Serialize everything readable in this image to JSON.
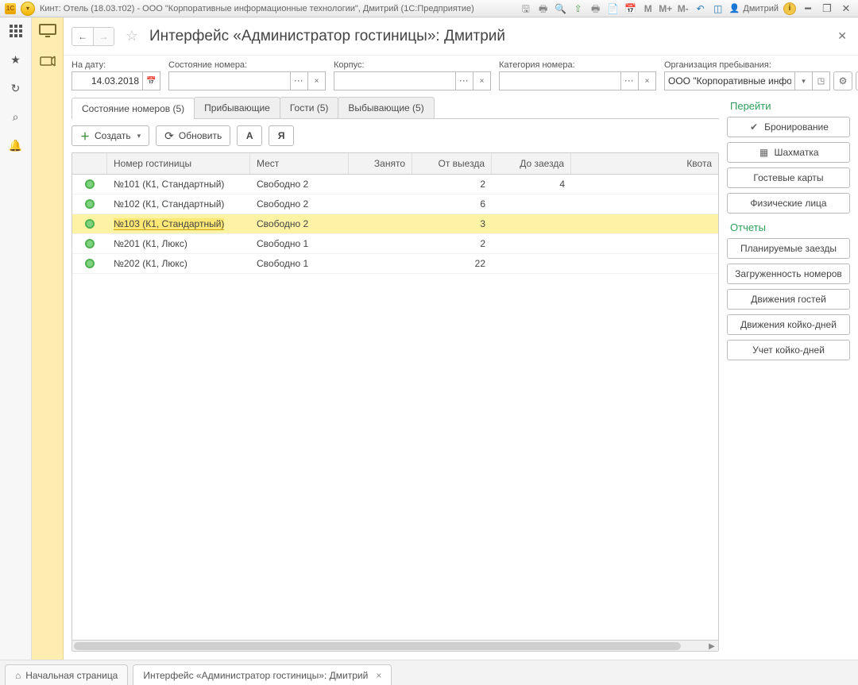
{
  "titlebar": {
    "logo": "1C",
    "title": "Кинт: Отель (18.03.т02) - ООО \"Корпоративные информационные технологии\", Дмитрий  (1С:Предприятие)",
    "icons": {
      "disk": "disk-icon",
      "print": "print-icon",
      "preview": "preview-icon",
      "arrow_up": "up-icon",
      "print2": "print-icon",
      "doc": "doc-icon",
      "calendar": "calendar-icon",
      "m": "М",
      "m_plus": "М+",
      "m_minus": "М-",
      "back": "back-icon",
      "layout": "layout-icon"
    },
    "user_name": "Дмитрий",
    "info": "i"
  },
  "page_header": {
    "title": "Интерфейс «Администратор гостиницы»: Дмитрий"
  },
  "filters": {
    "date_label": "На дату:",
    "date_value": "14.03.2018",
    "status_label": "Состояние номера:",
    "status_value": "",
    "building_label": "Корпус:",
    "building_value": "",
    "category_label": "Категория номера:",
    "category_value": "",
    "org_label": "Организация пребывания:",
    "org_value": "ООО \"Корпоративные информационные технологии\""
  },
  "tabs": [
    {
      "label": "Состояние номеров (5)",
      "active": true
    },
    {
      "label": "Прибывающие",
      "active": false
    },
    {
      "label": "Гости (5)",
      "active": false
    },
    {
      "label": "Выбывающие (5)",
      "active": false
    }
  ],
  "toolbar": {
    "create": "Создать",
    "refresh": "Обновить",
    "a": "А",
    "ya": "Я"
  },
  "grid": {
    "headers": {
      "c0": "",
      "c1": "Номер гостиницы",
      "c2": "Мест",
      "c3": "Занято",
      "c4": "От выезда",
      "c5": "До заезда",
      "c6": "Квота"
    },
    "rows": [
      {
        "room": "№101 (К1, Стандартный)",
        "places": "Свободно 2",
        "busy": "",
        "depart": "2",
        "arrive": "4",
        "quota": "",
        "sel": false
      },
      {
        "room": "№102 (К1, Стандартный)",
        "places": "Свободно 2",
        "busy": "",
        "depart": "6",
        "arrive": "",
        "quota": "",
        "sel": false
      },
      {
        "room": "№103 (К1, Стандартный)",
        "places": "Свободно 2",
        "busy": "",
        "depart": "3",
        "arrive": "",
        "quota": "",
        "sel": true
      },
      {
        "room": "№201 (К1, Люкс)",
        "places": "Свободно 1",
        "busy": "",
        "depart": "2",
        "arrive": "",
        "quota": "",
        "sel": false
      },
      {
        "room": "№202 (К1, Люкс)",
        "places": "Свободно 1",
        "busy": "",
        "depart": "22",
        "arrive": "",
        "quota": "",
        "sel": false
      }
    ]
  },
  "right_panel": {
    "go_title": "Перейти",
    "go_items": [
      {
        "icon": "✔",
        "label": "Бронирование"
      },
      {
        "icon": "▦",
        "label": "Шахматка"
      },
      {
        "icon": "",
        "label": "Гостевые карты"
      },
      {
        "icon": "",
        "label": "Физические лица"
      }
    ],
    "rep_title": "Отчеты",
    "rep_items": [
      {
        "label": "Планируемые заезды"
      },
      {
        "label": "Загруженность номеров"
      },
      {
        "label": "Движения гостей"
      },
      {
        "label": "Движения койко-дней"
      },
      {
        "label": "Учет койко-дней"
      }
    ]
  },
  "bottom_tabs": {
    "home": "Начальная страница",
    "current": "Интерфейс «Администратор гостиницы»: Дмитрий"
  }
}
